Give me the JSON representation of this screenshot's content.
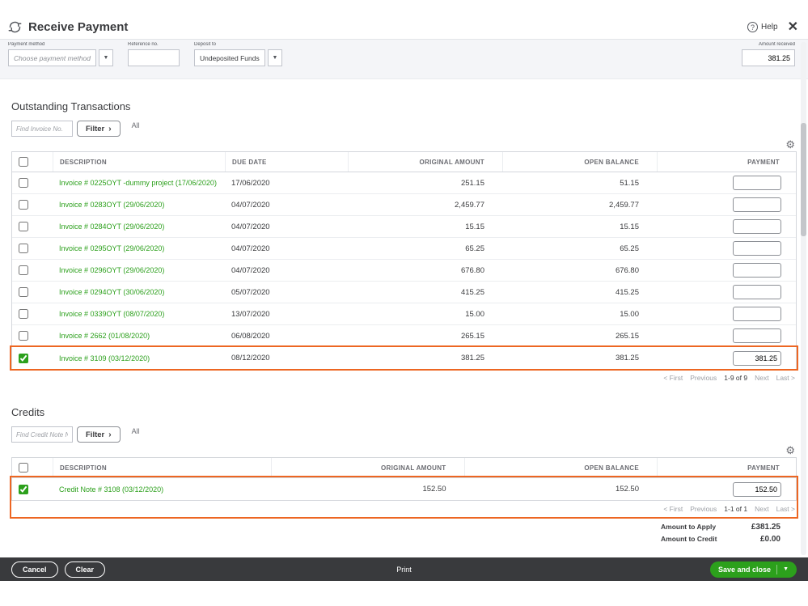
{
  "header": {
    "title": "Receive Payment",
    "help_label": "Help"
  },
  "icons": {
    "help": "?",
    "close": "✕",
    "gear": "⚙",
    "dropdown": "▼",
    "chevron_right": "›",
    "save_caret": "▼"
  },
  "form": {
    "payment_method_label": "Payment method",
    "payment_method_value": "Choose payment method",
    "reference_no_label": "Reference no.",
    "reference_no_value": "",
    "deposit_to_label": "Deposit to",
    "deposit_to_value": "Undeposited Funds",
    "amount_received_label": "Amount received",
    "amount_received_value": "381.25"
  },
  "outstanding": {
    "title": "Outstanding Transactions",
    "find_placeholder": "Find Invoice No.",
    "filter_label": "Filter",
    "all_label": "All",
    "columns": {
      "description": "DESCRIPTION",
      "due_date": "DUE DATE",
      "original_amount": "ORIGINAL AMOUNT",
      "open_balance": "OPEN BALANCE",
      "payment": "PAYMENT"
    },
    "rows": [
      {
        "description": "Invoice # 0225OYT -dummy project (17/06/2020)",
        "due_date": "17/06/2020",
        "original_amount": "251.15",
        "open_balance": "51.15",
        "payment": "",
        "checked": false
      },
      {
        "description": "Invoice # 0283OYT (29/06/2020)",
        "due_date": "04/07/2020",
        "original_amount": "2,459.77",
        "open_balance": "2,459.77",
        "payment": "",
        "checked": false
      },
      {
        "description": "Invoice # 0284OYT (29/06/2020)",
        "due_date": "04/07/2020",
        "original_amount": "15.15",
        "open_balance": "15.15",
        "payment": "",
        "checked": false
      },
      {
        "description": "Invoice # 0295OYT (29/06/2020)",
        "due_date": "04/07/2020",
        "original_amount": "65.25",
        "open_balance": "65.25",
        "payment": "",
        "checked": false
      },
      {
        "description": "Invoice # 0296OYT (29/06/2020)",
        "due_date": "04/07/2020",
        "original_amount": "676.80",
        "open_balance": "676.80",
        "payment": "",
        "checked": false
      },
      {
        "description": "Invoice # 0294OYT (30/06/2020)",
        "due_date": "05/07/2020",
        "original_amount": "415.25",
        "open_balance": "415.25",
        "payment": "",
        "checked": false
      },
      {
        "description": "Invoice # 0339OYT (08/07/2020)",
        "due_date": "13/07/2020",
        "original_amount": "15.00",
        "open_balance": "15.00",
        "payment": "",
        "checked": false
      },
      {
        "description": "Invoice # 2662 (01/08/2020)",
        "due_date": "06/08/2020",
        "original_amount": "265.15",
        "open_balance": "265.15",
        "payment": "",
        "checked": false
      },
      {
        "description": "Invoice # 3109 (03/12/2020)",
        "due_date": "08/12/2020",
        "original_amount": "381.25",
        "open_balance": "381.25",
        "payment": "381.25",
        "checked": true
      }
    ],
    "pager": {
      "first": "< First",
      "previous": "Previous",
      "range": "1-9 of 9",
      "next": "Next",
      "last": "Last >"
    }
  },
  "credits": {
    "title": "Credits",
    "find_placeholder": "Find Credit Note No.",
    "filter_label": "Filter",
    "all_label": "All",
    "columns": {
      "description": "DESCRIPTION",
      "original_amount": "ORIGINAL AMOUNT",
      "open_balance": "OPEN BALANCE",
      "payment": "PAYMENT"
    },
    "rows": [
      {
        "description": "Credit Note # 3108 (03/12/2020)",
        "original_amount": "152.50",
        "open_balance": "152.50",
        "payment": "152.50",
        "checked": true
      }
    ],
    "pager": {
      "first": "< First",
      "previous": "Previous",
      "range": "1-1 of 1",
      "next": "Next",
      "last": "Last >"
    }
  },
  "summary": {
    "amount_to_apply_label": "Amount to Apply",
    "amount_to_apply_value": "£381.25",
    "amount_to_credit_label": "Amount to Credit",
    "amount_to_credit_value": "£0.00"
  },
  "footer": {
    "cancel_label": "Cancel",
    "clear_label": "Clear",
    "print_label": "Print",
    "save_label": "Save and close"
  },
  "colors": {
    "accent_green": "#2ca01c",
    "highlight_orange": "#ed6622",
    "footer_dark": "#393a3d"
  }
}
